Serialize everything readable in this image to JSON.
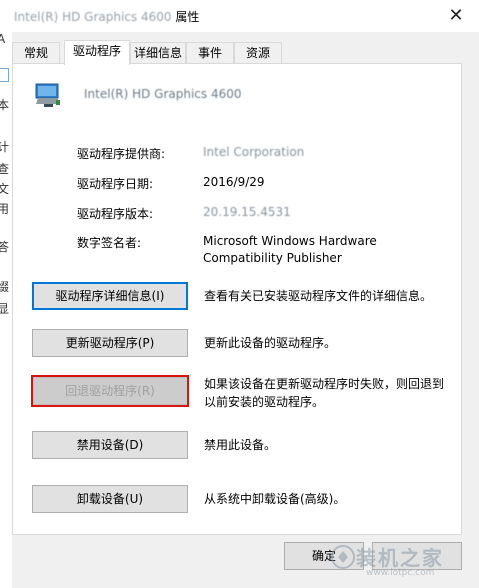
{
  "window": {
    "title_blurred": "Intel(R) HD Graphics 4600",
    "title_suffix": "属性",
    "close_glyph": "✕"
  },
  "tabs": [
    {
      "label": "常规"
    },
    {
      "label": "驱动程序"
    },
    {
      "label": "详细信息"
    },
    {
      "label": "事件"
    },
    {
      "label": "资源"
    }
  ],
  "device": {
    "name": "Intel(R) HD Graphics 4600",
    "icon": "display-adapter-icon"
  },
  "info": {
    "provider_label": "驱动程序提供商:",
    "provider_value": "Intel Corporation",
    "date_label": "驱动程序日期:",
    "date_value": "2016/9/29",
    "version_label": "驱动程序版本:",
    "version_value": "20.19.15.4531",
    "signer_label": "数字签名者:",
    "signer_value_line1": "Microsoft Windows Hardware",
    "signer_value_line2": "Compatibility Publisher"
  },
  "actions": {
    "details_btn": "驱动程序详细信息(I)",
    "details_desc": "查看有关已安装驱动程序文件的详细信息。",
    "update_btn": "更新驱动程序(P)",
    "update_desc": "更新此设备的驱动程序。",
    "rollback_btn": "回退驱动程序(R)",
    "rollback_desc_line1": "如果该设备在更新驱动程序时失败，则回退到",
    "rollback_desc_line2": "以前安装的驱动程序。",
    "disable_btn": "禁用设备(D)",
    "disable_desc": "禁用此设备。",
    "uninstall_btn": "卸载设备(U)",
    "uninstall_desc": "从系统中卸载设备(高级)。"
  },
  "footer": {
    "ok_label": "确定"
  },
  "watermark": {
    "text": "装机之家",
    "url": "www.lotpc.com"
  },
  "background_window": {
    "glyphs": [
      "A",
      "本",
      "计",
      "查",
      "文",
      "用",
      "答",
      "缀",
      "显"
    ]
  },
  "colors": {
    "highlight_border": "#d9140f",
    "focus_border": "#0078d7"
  }
}
